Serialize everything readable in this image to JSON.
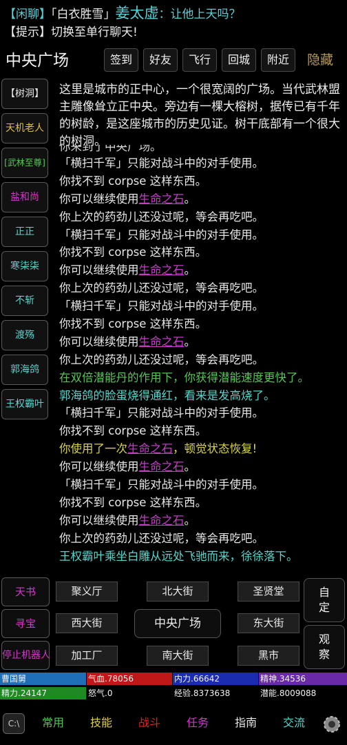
{
  "chat": {
    "line1": {
      "channel": "【闲聊】",
      "speaker_title": "「白衣胜雪」",
      "speaker": "姜太虚",
      "text": "：让他上天吗？"
    },
    "line2": {
      "channel": "【提示】",
      "text": "切换至单行聊天!"
    }
  },
  "header": {
    "room_title": "中央广场",
    "buttons": [
      "签到",
      "好友",
      "飞行",
      "回城",
      "附近"
    ],
    "hide_label": "隐藏"
  },
  "npcs": [
    {
      "label": "【树洞】",
      "color": "#e6e6e6"
    },
    {
      "label": "天机老人",
      "color": "#e0c040"
    },
    {
      "label": "[武林至尊]",
      "color": "#58c458"
    },
    {
      "label": "盐和尚",
      "color": "#d338c8"
    },
    {
      "label": "正正",
      "color": "#5ad4cc"
    },
    {
      "label": "寒柒柒",
      "color": "#5ad4cc"
    },
    {
      "label": "不斩",
      "color": "#5ad4cc"
    },
    {
      "label": "渡殇",
      "color": "#5ad4cc"
    },
    {
      "label": "郭海鸽",
      "color": "#5ad4cc"
    },
    {
      "label": "王权霸叶",
      "color": "#5ad4cc"
    }
  ],
  "description": "这里是城市的正中心，一个很宽阔的广场。当代武林盟主雕像耸立正中央。旁边有一棵大榕树，据传已有千年的树龄，是这座城市的历史见证。树干底部有一个很大的树洞。",
  "log_partial": "你来到了中央广场。",
  "log": [
    {
      "text": "「横扫千军」只能对战斗中的对手使用。"
    },
    {
      "text": "你找不到 corpse 这样东西。"
    },
    {
      "text": "你可以继续使用",
      "link": "生命之石",
      "after": "。"
    },
    {
      "text": "你上次的药劲儿还没过呢，等会再吃吧。"
    },
    {
      "text": "「横扫千军」只能对战斗中的对手使用。"
    },
    {
      "text": "你找不到 corpse 这样东西。"
    },
    {
      "text": "你可以继续使用",
      "link": "生命之石",
      "after": "。"
    },
    {
      "text": "你上次的药劲儿还没过呢，等会再吃吧。"
    },
    {
      "text": "「横扫千军」只能对战斗中的对手使用。"
    },
    {
      "text": "你找不到 corpse 这样东西。"
    },
    {
      "text": "你可以继续使用",
      "link": "生命之石",
      "after": "。"
    },
    {
      "text": "你上次的药劲儿还没过呢，等会再吃吧。"
    },
    {
      "text": "在双倍潜能丹的作用下，你获得潜能速度更快了。",
      "color": "#58c458"
    },
    {
      "text": "郭海鸽的脸蛋烧得通红，看来是发高烧了。",
      "color": "#5ad4cc"
    },
    {
      "text": "「横扫千军」只能对战斗中的对手使用。"
    },
    {
      "text": "你找不到 corpse 这样东西。"
    },
    {
      "text": "你使用了一次",
      "link": "生命之石",
      "after": "，顿觉状态恢复!",
      "color": "#d8d444"
    },
    {
      "text": "你可以继续使用",
      "link": "生命之石",
      "after": "。"
    },
    {
      "text": "「横扫千军」只能对战斗中的对手使用。"
    },
    {
      "text": "你找不到 corpse 这样东西。"
    },
    {
      "text": "你可以继续使用",
      "link": "生命之石",
      "after": "。"
    },
    {
      "text": "你上次的药劲儿还没过呢，等会再吃吧。"
    },
    {
      "text": "王权霸叶乘坐白雕从远处飞驰而来，徐徐落下。",
      "color": "#5ad4cc"
    }
  ],
  "side_buttons": [
    "天书",
    "寻宝",
    "停止机器人"
  ],
  "exits": {
    "north_west": "聚义厅",
    "north": "北大街",
    "north_east": "圣贤堂",
    "west": "西大街",
    "center": "中央广场",
    "east": "东大街",
    "south_west": "加工厂",
    "south": "南大街",
    "south_east": "黑市"
  },
  "right_buttons": [
    {
      "line1": "自",
      "line2": "定"
    },
    {
      "line1": "观",
      "line2": "察"
    }
  ],
  "stats": {
    "row1": [
      {
        "text": "曹国舅",
        "bg": "#1e6fb8"
      },
      {
        "text": "气血.78056",
        "bg": "#c01818"
      },
      {
        "text": "内力.66642",
        "bg": "#1c2cb0"
      },
      {
        "text": "精神.34536",
        "bg": "#6a2aa8"
      }
    ],
    "row2": [
      {
        "text": "精力.24147",
        "bg": "#1f8a24"
      },
      {
        "text": "怒气.0",
        "bg": "#000000"
      },
      {
        "text": "经验.8373638",
        "bg": "#000000"
      },
      {
        "text": "潜能.8009088",
        "bg": "#000000"
      }
    ]
  },
  "nav": {
    "left_icon": "C:\\",
    "items": [
      {
        "label": "常用",
        "color": "#58c458"
      },
      {
        "label": "技能",
        "color": "#e0d040"
      },
      {
        "label": "战斗",
        "color": "#e02020"
      },
      {
        "label": "任务",
        "color": "#d338c8"
      },
      {
        "label": "指南",
        "color": "#e6e6e6"
      },
      {
        "label": "交流",
        "color": "#5ad4cc"
      }
    ],
    "right_icon": "gear-icon"
  }
}
